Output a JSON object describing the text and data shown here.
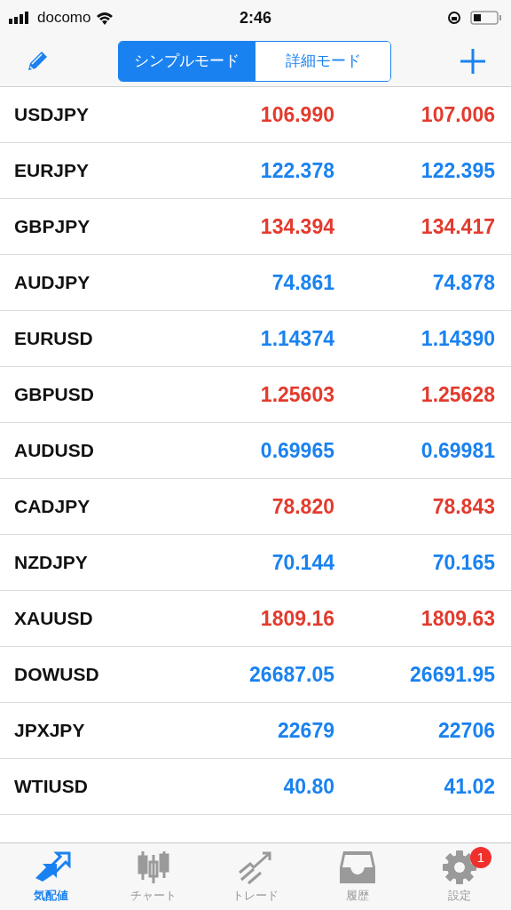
{
  "status_bar": {
    "carrier": "docomo",
    "time": "2:46"
  },
  "segments": [
    {
      "label": "シンプルモード",
      "selected": true
    },
    {
      "label": "詳細モード",
      "selected": false
    }
  ],
  "quotes": [
    {
      "symbol": "USDJPY",
      "bid": "106.990",
      "ask": "107.006",
      "color": "#e23b2e"
    },
    {
      "symbol": "EURJPY",
      "bid": "122.378",
      "ask": "122.395",
      "color": "#1a82f0"
    },
    {
      "symbol": "GBPJPY",
      "bid": "134.394",
      "ask": "134.417",
      "color": "#e23b2e"
    },
    {
      "symbol": "AUDJPY",
      "bid": "74.861",
      "ask": "74.878",
      "color": "#1a82f0"
    },
    {
      "symbol": "EURUSD",
      "bid": "1.14374",
      "ask": "1.14390",
      "color": "#1a82f0"
    },
    {
      "symbol": "GBPUSD",
      "bid": "1.25603",
      "ask": "1.25628",
      "color": "#e23b2e"
    },
    {
      "symbol": "AUDUSD",
      "bid": "0.69965",
      "ask": "0.69981",
      "color": "#1a82f0"
    },
    {
      "symbol": "CADJPY",
      "bid": "78.820",
      "ask": "78.843",
      "color": "#e23b2e"
    },
    {
      "symbol": "NZDJPY",
      "bid": "70.144",
      "ask": "70.165",
      "color": "#1a82f0"
    },
    {
      "symbol": "XAUUSD",
      "bid": "1809.16",
      "ask": "1809.63",
      "color": "#e23b2e"
    },
    {
      "symbol": "DOWUSD",
      "bid": "26687.05",
      "ask": "26691.95",
      "color": "#1a82f0"
    },
    {
      "symbol": "JPXJPY",
      "bid": "22679",
      "ask": "22706",
      "color": "#1a82f0"
    },
    {
      "symbol": "WTIUSD",
      "bid": "40.80",
      "ask": "41.02",
      "color": "#1a82f0"
    }
  ],
  "tab_bar": [
    {
      "kind": "quotes",
      "label": "気配値",
      "selected": true
    },
    {
      "kind": "chart",
      "label": "チャート",
      "selected": false
    },
    {
      "kind": "trade",
      "label": "トレード",
      "selected": false
    },
    {
      "kind": "history",
      "label": "履歴",
      "selected": false
    },
    {
      "kind": "settings",
      "label": "設定",
      "selected": false,
      "badge": "1"
    }
  ]
}
